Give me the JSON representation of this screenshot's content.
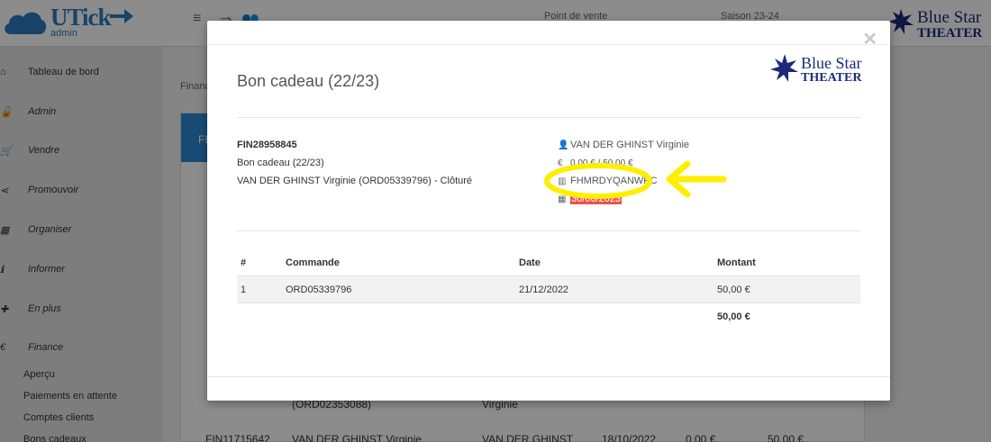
{
  "app": {
    "logo_text": "UTick",
    "logo_sub": "admin",
    "topbar_menu_icon": "menu-icon",
    "point_de_vente": "Point de vente",
    "saison": "Saison 23-24",
    "brand_line1": "Blue Star",
    "brand_line2": "THEATER"
  },
  "sidebar": {
    "items": [
      {
        "label": "Tableau de bord",
        "icon": "home-icon"
      },
      {
        "label": "Admin",
        "icon": "lock-icon"
      },
      {
        "label": "Vendre",
        "icon": "cart-icon"
      },
      {
        "label": "Promouvoir",
        "icon": "share-icon"
      },
      {
        "label": "Organiser",
        "icon": "calendar-icon"
      },
      {
        "label": "Informer",
        "icon": "info-icon"
      },
      {
        "label": "En plus",
        "icon": "plus-icon"
      },
      {
        "label": "Finance",
        "icon": "euro-icon"
      }
    ],
    "sub_items": [
      "Aperçu",
      "Paiements en attente",
      "Comptes clients",
      "Bons cadeaux"
    ]
  },
  "background": {
    "breadcrumb": "Finance",
    "panel_head": "FIN",
    "row_partial": {
      "order": "(ORD02353088)",
      "name": "Virginie"
    },
    "row_last": {
      "id": "FIN11715642",
      "client": "VAN DER GHINST Virginie",
      "client2": "VAN DER GHINST",
      "date": "18/10/2022",
      "amount1": "0,00 €",
      "amount2": "50,00 €"
    }
  },
  "modal": {
    "title": "Bon cadeau (22/23)",
    "brand_line1": "Blue Star",
    "brand_line2": "THEATER",
    "left": {
      "code": "FIN28958845",
      "name": "Bon cadeau (22/23)",
      "owner": "VAN DER GHINST Virginie (ORD05339796) - Clôturé"
    },
    "right": {
      "person": "VAN DER GHINST Virginie",
      "price": "0,00 € / 50,00 €",
      "voucher_code": "FHMRDYQANWPC",
      "expiry": "30/06/2023"
    },
    "table": {
      "headers": [
        "#",
        "Commande",
        "Date",
        "Montant"
      ],
      "rows": [
        {
          "num": "1",
          "commande": "ORD05339796",
          "date": "21/12/2022",
          "montant": "50,00 €"
        }
      ],
      "total": "50,00 €"
    }
  },
  "colors": {
    "accent": "#2b89d8",
    "date_highlight": "#e8524a",
    "annotation": "#ffee00",
    "brand": "#1b2a7a"
  }
}
